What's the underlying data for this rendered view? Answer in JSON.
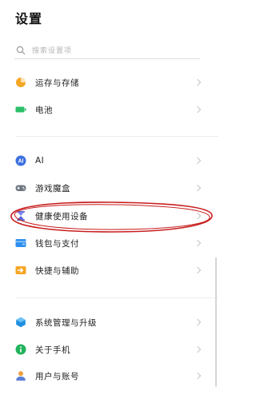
{
  "header": {
    "title": "设置"
  },
  "search": {
    "placeholder": "搜索设置项"
  },
  "colors": {
    "storage": "#f5a623",
    "battery": "#2bbf6a",
    "ai": "#3b6fe0",
    "game": "#6f7780",
    "health": "#5565d9",
    "wallet": "#2d8ff0",
    "shortcut": "#f5a623",
    "system": "#1f8fe0",
    "about": "#22b25c",
    "user": "#f0a040",
    "annotation": "#c81e1e"
  },
  "groups": [
    {
      "items": [
        {
          "label": "运存与存储",
          "icon": "storage-pie-icon"
        },
        {
          "label": "电池",
          "icon": "battery-icon"
        }
      ]
    },
    {
      "items": [
        {
          "label": "AI",
          "icon": "ai-badge-icon"
        },
        {
          "label": "游戏魔盒",
          "icon": "gamepad-icon"
        },
        {
          "label": "健康使用设备",
          "icon": "hourglass-icon",
          "highlighted": true
        },
        {
          "label": "钱包与支付",
          "icon": "wallet-icon"
        },
        {
          "label": "快捷与辅助",
          "icon": "shortcut-arrow-icon"
        }
      ]
    },
    {
      "items": [
        {
          "label": "系统管理与升级",
          "icon": "system-cube-icon"
        },
        {
          "label": "关于手机",
          "icon": "info-icon"
        },
        {
          "label": "用户与账号",
          "icon": "user-icon"
        }
      ]
    }
  ]
}
